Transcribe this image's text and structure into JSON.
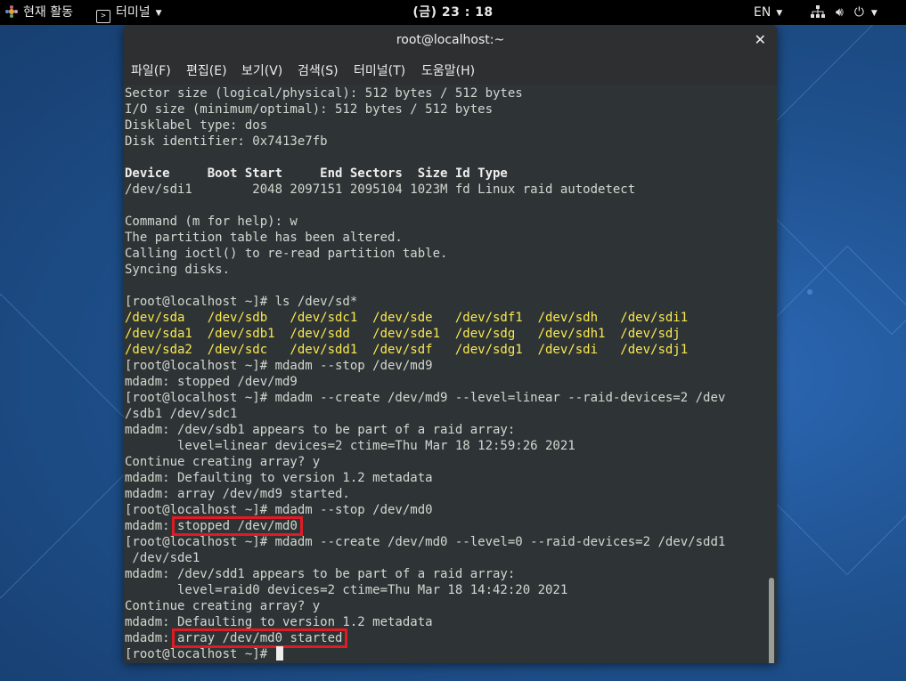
{
  "topbar": {
    "activities": "현재 활동",
    "app_name": "터미널",
    "clock": "(금) 23 : 18",
    "lang": "EN"
  },
  "window": {
    "title": "root@localhost:~",
    "menu": [
      "파일(F)",
      "편집(E)",
      "보기(V)",
      "검색(S)",
      "터미널(T)",
      "도움말(H)"
    ]
  },
  "terminal": {
    "l1": "Sector size (logical/physical): 512 bytes / 512 bytes",
    "l2": "I/O size (minimum/optimal): 512 bytes / 512 bytes",
    "l3": "Disklabel type: dos",
    "l4": "Disk identifier: 0x7413e7fb",
    "header": "Device     Boot Start     End Sectors  Size Id Type",
    "part": "/dev/sdi1        2048 2097151 2095104 1023M fd Linux raid autodetect",
    "cmd_w": "Command (m for help): w",
    "altered": "The partition table has been altered.",
    "ioctl": "Calling ioctl() to re-read partition table.",
    "sync": "Syncing disks.",
    "prompt_ls": "[root@localhost ~]# ls /dev/sd*",
    "ls_row1": "/dev/sda   /dev/sdb   /dev/sdc1  /dev/sde   /dev/sdf1  /dev/sdh   /dev/sdi1",
    "ls_row2": "/dev/sda1  /dev/sdb1  /dev/sdd   /dev/sde1  /dev/sdg   /dev/sdh1  /dev/sdj",
    "ls_row3": "/dev/sda2  /dev/sdc   /dev/sdd1  /dev/sdf   /dev/sdg1  /dev/sdi   /dev/sdj1",
    "stop_md9": "[root@localhost ~]# mdadm --stop /dev/md9",
    "stopped_md9": "mdadm: stopped /dev/md9",
    "create_md9_a": "[root@localhost ~]# mdadm --create /dev/md9 --level=linear --raid-devices=2 /dev",
    "create_md9_b": "/sdb1 /dev/sdc1",
    "sdb1_part": "mdadm: /dev/sdb1 appears to be part of a raid array:",
    "sdb1_info": "       level=linear devices=2 ctime=Thu Mar 18 12:59:26 2021",
    "continue1": "Continue creating array? y",
    "default1": "mdadm: Defaulting to version 1.2 metadata",
    "started_md9": "mdadm: array /dev/md9 started.",
    "stop_md0": "[root@localhost ~]# mdadm --stop /dev/md0",
    "mdadm_prefix": "mdadm: ",
    "stopped_md0": "stopped /dev/md0",
    "create_md0_a": "[root@localhost ~]# mdadm --create /dev/md0 --level=0 --raid-devices=2 /dev/sdd1",
    "create_md0_b": " /dev/sde1",
    "sdd1_part": "mdadm: /dev/sdd1 appears to be part of a raid array:",
    "sdd1_info": "       level=raid0 devices=2 ctime=Thu Mar 18 14:42:20 2021",
    "continue2": "Continue creating array? y",
    "default2": "mdadm: Defaulting to version 1.2 metadata",
    "started_md0": "array /dev/md0 started",
    "prompt_final": "[root@localhost ~]# "
  },
  "colors": {
    "highlight": "#e01b24",
    "ls_color": "#fce94f",
    "terminal_bg": "#2e3436"
  }
}
